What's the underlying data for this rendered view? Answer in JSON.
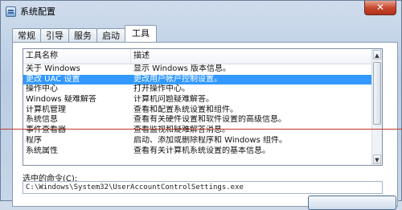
{
  "window": {
    "title": "系统配置",
    "close_symbol": "✕"
  },
  "tabs": [
    {
      "label": "常规"
    },
    {
      "label": "引导"
    },
    {
      "label": "服务"
    },
    {
      "label": "启动"
    },
    {
      "label": "工具",
      "active": true
    }
  ],
  "tools_list": {
    "columns": [
      "工具名称",
      "描述"
    ],
    "rows": [
      {
        "name": "关于 Windows",
        "desc": "显示 Windows 版本信息。"
      },
      {
        "name": "更改 UAC 设置",
        "desc": "更改用户帐户控制设置。",
        "selected": true
      },
      {
        "name": "操作中心",
        "desc": "打开操作中心。"
      },
      {
        "name": "Windows 疑难解答",
        "desc": "计算机问题疑难解答。"
      },
      {
        "name": "计算机管理",
        "desc": "查看和配置系统设置和组件。"
      },
      {
        "name": "系统信息",
        "desc": "查看有关硬件设置和软件设置的高级信息。"
      },
      {
        "name": "事件查看器",
        "desc": "查看监视和疑难解答消息。"
      },
      {
        "name": "程序",
        "desc": "启动、添加或删除程序和 Windows 组件。"
      },
      {
        "name": "系统属性",
        "desc": "查看有关计算机系统设置的基本信息。"
      }
    ]
  },
  "selected_command": {
    "label": "选中的命令(C):",
    "value": "C:\\Windows\\System32\\UserAccountControlSettings.exe"
  },
  "colors": {
    "selection": "#3399ff",
    "annotation_line": "#c0392b"
  }
}
